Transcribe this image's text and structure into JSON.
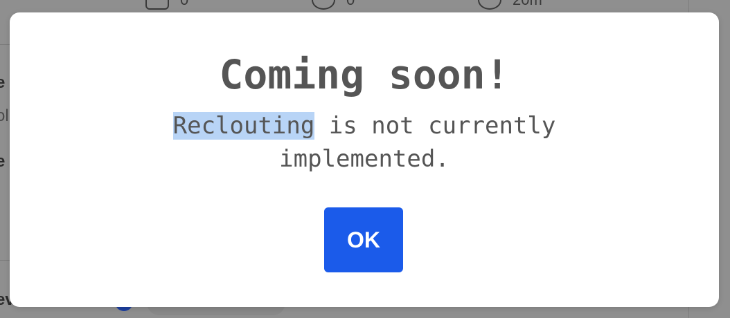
{
  "background": {
    "stats": [
      "0",
      "0",
      "20m"
    ],
    "left_fragments": [
      "e",
      "ol",
      "e",
      "ev"
    ]
  },
  "modal": {
    "title": "Coming soon!",
    "message_highlight": "Reclouting",
    "message_rest_line1": " is not currently",
    "message_line2": "implemented.",
    "ok_label": "OK"
  },
  "colors": {
    "accent": "#1b5bea",
    "text": "#555555",
    "selection": "#b8d4f6",
    "overlay": "#8f8f8f"
  }
}
